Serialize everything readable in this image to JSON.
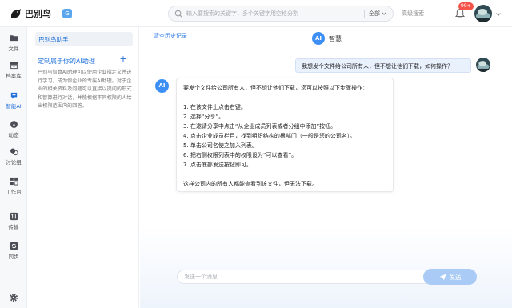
{
  "topbar": {
    "logo_text": "巴别鸟",
    "app_badge": "G",
    "search_placeholder": "输入要搜索的关键字，多个关键字用空格分割",
    "search_scope": "全部",
    "advanced_search": "高级搜索",
    "notification_count": "99+"
  },
  "nav": {
    "items": [
      {
        "label": "文件",
        "icon": "folder-icon"
      },
      {
        "label": "档案库",
        "icon": "archive-icon"
      },
      {
        "label": "智能AI",
        "icon": "ai-icon",
        "active": true
      },
      {
        "label": "动态",
        "icon": "activity-icon"
      },
      {
        "label": "讨论组",
        "icon": "chat-icon"
      },
      {
        "label": "工作台",
        "icon": "workbench-icon"
      },
      {
        "label": "传输",
        "icon": "transfer-icon"
      },
      {
        "label": "同步",
        "icon": "sync-icon"
      }
    ]
  },
  "panel": {
    "assistant_name": "巴别鸟助手",
    "custom_title": "定制属于你的AI助理",
    "add_symbol": "+",
    "custom_desc": "巴别鸟智算AI助理可以使用企业指定文件进行学习，成为你企业的专属AI助理。对于企业的相关资料及问题可以直接以提问的形式和智算进行对话，并能根据不同权限的人给出权限范围内的回答。"
  },
  "chat": {
    "clear_history": "清空历史记录",
    "header_logo": "AI",
    "header_title": "智慧",
    "user_message": "我想发个文件给公司所有人，但不想让他们下载，如何操作？",
    "bot_logo": "AI",
    "bot_lines": [
      "要发个文件给公司所有人，但不想让他们下载，您可以按照以下步骤操作：",
      "",
      "1. 在该文件上点击右键。",
      "2. 选择“分享”。",
      "3. 在邀请分享中点击“从企业成员列表或者分组中添加”按钮。",
      "4. 点击企业成员栏目，找到组织结构的根部门（一般是您的公司名）。",
      "5. 单击公司名使之加入列表。",
      "6. 把右侧权限列表中的权限设为“可以查看”。",
      "7. 点击底部发送按钮即可。",
      "",
      "这样公司内的所有人都能查看到该文件，但无法下载。"
    ],
    "input_placeholder": "发送一个消息",
    "send_label": "发送"
  },
  "colors": {
    "accent": "#1e6fd9",
    "ai_blue": "#3d8ff5",
    "badge_red": "#f5524a",
    "send_button": "#a9cbf5"
  }
}
